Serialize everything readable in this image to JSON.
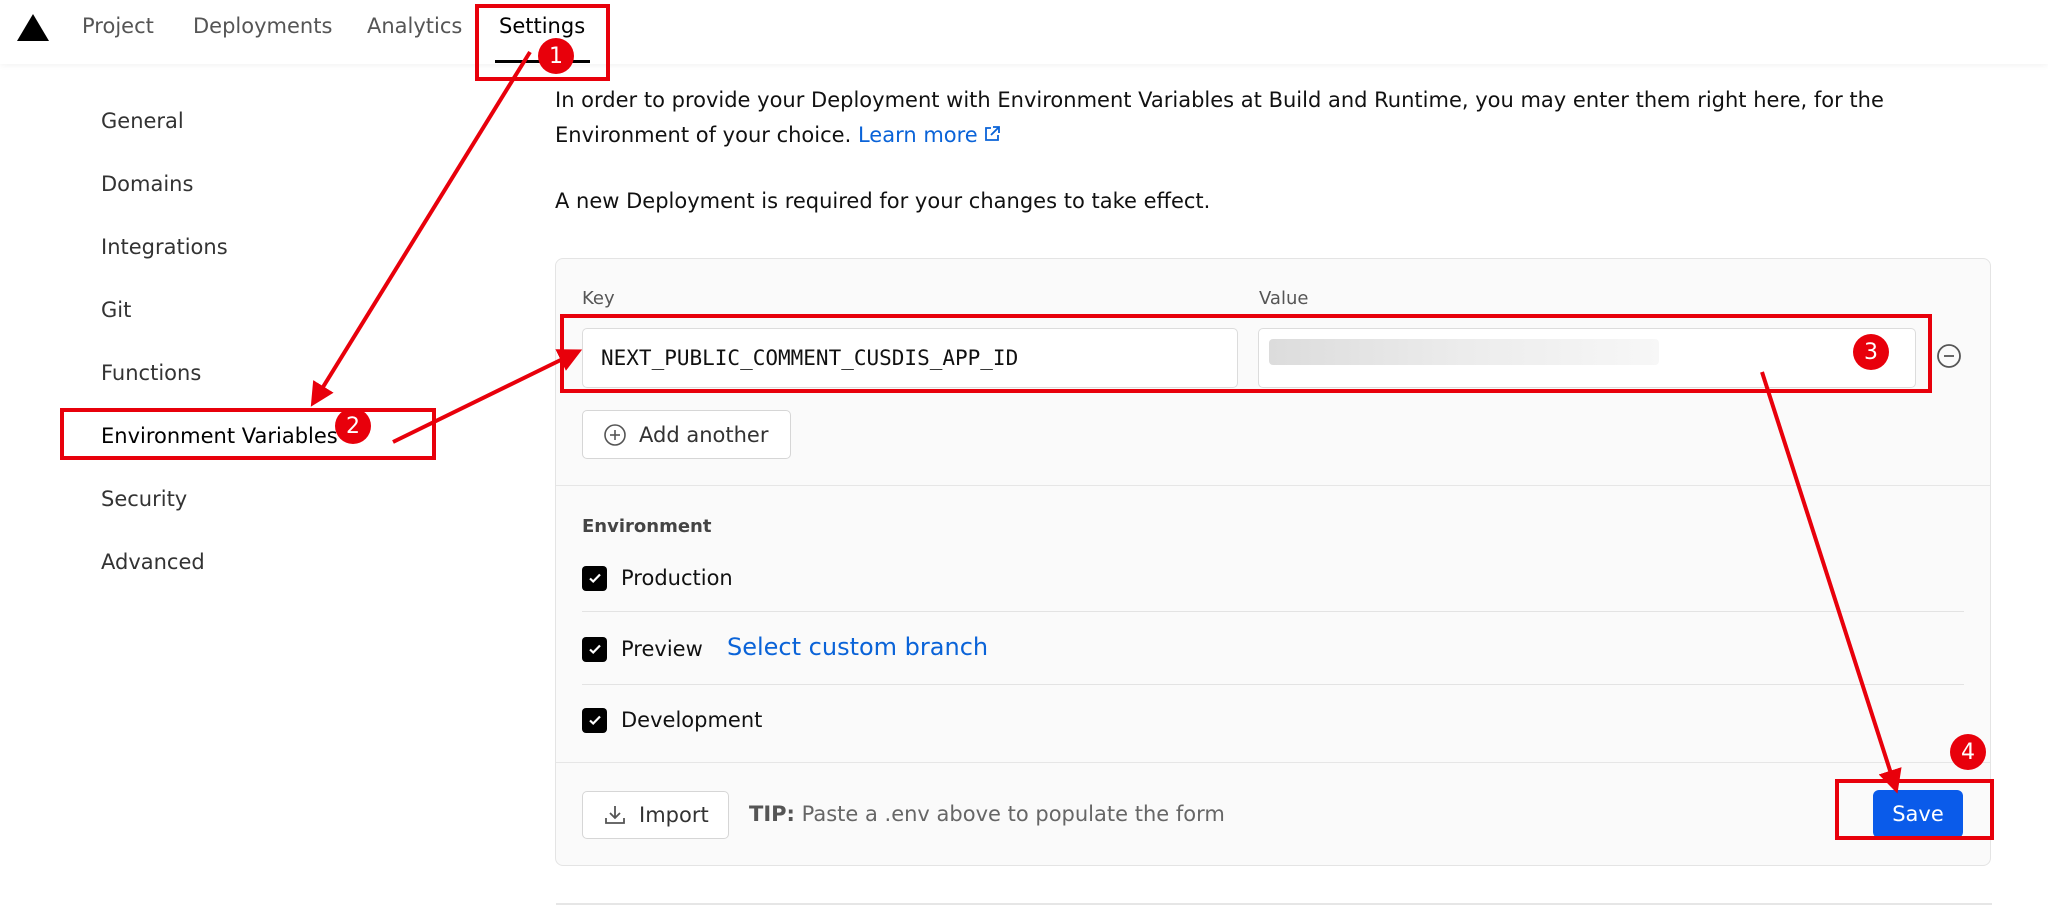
{
  "nav": {
    "tabs": [
      "Project",
      "Deployments",
      "Analytics",
      "Settings"
    ],
    "active": "Settings"
  },
  "sidebar": {
    "items": [
      "General",
      "Domains",
      "Integrations",
      "Git",
      "Functions",
      "Environment Variables",
      "Security",
      "Advanced"
    ],
    "active": "Environment Variables"
  },
  "intro": {
    "text": "In order to provide your Deployment with Environment Variables at Build and Runtime, you may enter them right here, for the Environment of your choice.",
    "learn_more": "Learn more",
    "notice": "A new Deployment is required for your changes to take effect."
  },
  "form": {
    "key_label": "Key",
    "value_label": "Value",
    "key_value": "NEXT_PUBLIC_COMMENT_CUSDIS_APP_ID",
    "add_another": "Add another"
  },
  "environment": {
    "title": "Environment",
    "options": [
      {
        "label": "Production",
        "checked": true
      },
      {
        "label": "Preview",
        "checked": true
      },
      {
        "label": "Development",
        "checked": true
      }
    ],
    "select_branch": "Select custom branch"
  },
  "footer": {
    "import": "Import",
    "tip_label": "TIP:",
    "tip_text": "Paste a .env above to populate the form",
    "save": "Save"
  },
  "annotations": {
    "badges": [
      "1",
      "2",
      "3",
      "4"
    ],
    "color": "#e8000b"
  },
  "colors": {
    "link": "#0a63d8",
    "primary_button": "#0a5bea"
  }
}
